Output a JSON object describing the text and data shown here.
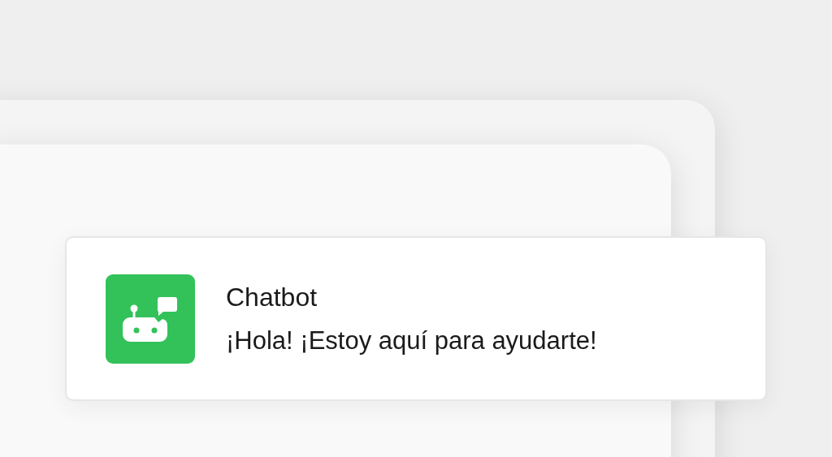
{
  "notification": {
    "title": "Chatbot",
    "message": "¡Hola! ¡Estoy aquí para ayudarte!"
  }
}
